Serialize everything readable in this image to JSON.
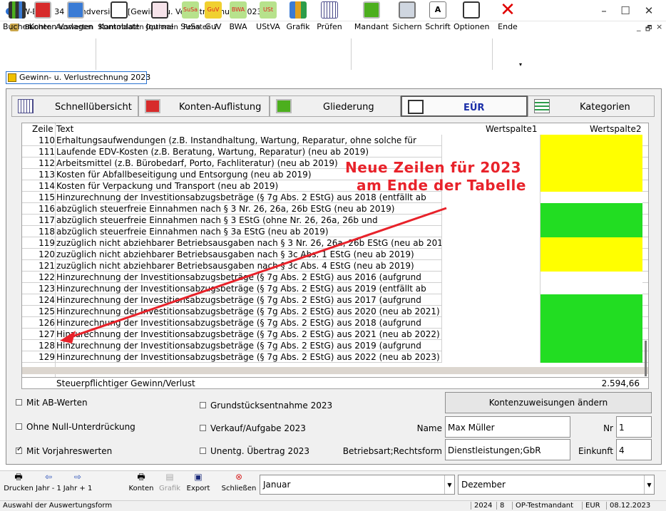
{
  "window": {
    "title": "RW-Buch 34 Grundversion  - [Gewinn- u. Verlustrechnung 2023]",
    "minimize": "–",
    "maximize": "☐",
    "close": "✕"
  },
  "menu": {
    "items": [
      "Buchen",
      "Auswerten",
      "Stammdaten",
      "Optionen",
      "Fenster",
      "?"
    ],
    "mdi_minimize": "_",
    "mdi_restore": "🗗",
    "mdi_close": "×"
  },
  "toolbar": {
    "buttons": [
      {
        "label": "Buchen",
        "icon": "ledger-icon"
      },
      {
        "label": "Konten",
        "icon": "accounts-icon"
      },
      {
        "label": "Vorlagen",
        "icon": "templates-icon"
      },
      {
        "label": "Kontoblatt",
        "icon": "account-sheet-icon"
      },
      {
        "label": "Journal",
        "icon": "journal-icon"
      },
      {
        "label": "SuSa",
        "icon": "susa-icon"
      },
      {
        "label": "GuV",
        "icon": "guv-icon"
      },
      {
        "label": "BWA",
        "icon": "bwa-icon"
      },
      {
        "label": "UStVA",
        "icon": "ustva-icon"
      },
      {
        "label": "Grafik",
        "icon": "chart-icon"
      },
      {
        "label": "Prüfen",
        "icon": "check-icon"
      },
      {
        "label": "Mandant",
        "icon": "client-icon"
      },
      {
        "label": "Sichern",
        "icon": "backup-icon"
      },
      {
        "label": "Schrift",
        "icon": "font-icon"
      },
      {
        "label": "Optionen",
        "icon": "options-icon"
      },
      {
        "label": "Ende",
        "icon": "exit-icon"
      }
    ],
    "icon_texts": {
      "susa": "SuSa",
      "guv": "GuV",
      "bwa": "BWA",
      "ust": "USt"
    },
    "colors": {
      "exit": "#e00000",
      "green": "#4caf1e",
      "red": "#d72b2b"
    }
  },
  "doc_tab": {
    "label": "Gewinn- u. Verlustrechnung 2023"
  },
  "view_tabs": [
    {
      "label": "Schnellübersicht",
      "icon": "calendar-grid-icon",
      "active": false
    },
    {
      "label": "Konten-Auflistung",
      "icon": "box-icon",
      "active": false
    },
    {
      "label": "Gliederung",
      "icon": "box-icon",
      "active": false
    },
    {
      "label": "EÜR",
      "icon": "euer-icon",
      "active": true
    },
    {
      "label": "Kategorien",
      "icon": "categories-icon",
      "active": false
    }
  ],
  "grid": {
    "headers": {
      "zeile": "Zeile",
      "text": "Text",
      "w1": "Wertspalte1",
      "w2": "Wertspalte2"
    },
    "rows": [
      {
        "nr": "110",
        "text": "Erhaltungsaufwendungen (z.B. Instandhaltung, Wartung, Reparatur, ohne solche für",
        "w2": "yellow"
      },
      {
        "nr": "111",
        "text": "Laufende EDV-Kosten (z.B. Beratung, Wartung, Reparatur) (neu ab 2019)",
        "w2": "yellow"
      },
      {
        "nr": "112",
        "text": "Arbeitsmittel (z.B. Bürobedarf, Porto, Fachliteratur) (neu ab 2019)",
        "w2": "yellow"
      },
      {
        "nr": "113",
        "text": "Kosten für Abfallbeseitigung und Entsorgung (neu ab 2019)",
        "w2": "yellow"
      },
      {
        "nr": "114",
        "text": "Kosten für Verpackung und Transport (neu ab 2019)",
        "w2": "yellow"
      },
      {
        "nr": "115",
        "text": "Hinzurechnung der Investitionsabzugsbeträge (§ 7g Abs. 2 EStG) aus 2018 (entfällt ab",
        "w2": "white"
      },
      {
        "nr": "116",
        "text": "abzüglich steuerfreie Einnahmen nach § 3 Nr. 26, 26a, 26b EStG (neu ab 2019)",
        "w2": "green"
      },
      {
        "nr": "117",
        "text": "abzüglich steuerfreie Einnahmen nach § 3 EStG (ohne Nr. 26, 26a, 26b und",
        "w2": "green"
      },
      {
        "nr": "118",
        "text": "abzüglich steuerfreie Einnahmen nach § 3a EStG (neu ab 2019)",
        "w2": "green"
      },
      {
        "nr": "119",
        "text": "zuzüglich nicht abziehbarer Betriebsausgaben nach § 3 Nr. 26, 26a, 26b EStG (neu ab 2019)",
        "w2": "yellow"
      },
      {
        "nr": "120",
        "text": "zuzüglich nicht abziehbarer Betriebsausgaben nach § 3c Abs. 1 EStG (neu ab 2019)",
        "w2": "yellow"
      },
      {
        "nr": "121",
        "text": "zuzüglich nicht abziehbarer Betriebsausgaben nach § 3c Abs. 4 EStG (neu ab 2019)",
        "w2": "yellow"
      },
      {
        "nr": "122",
        "text": "Hinzurechnung der Investitionsabzugsbeträge (§ 7g Abs. 2 EStG) aus 2016 (aufgrund",
        "w2": "white"
      },
      {
        "nr": "123",
        "text": "Hinzurechnung der Investitionsabzugsbeträge (§ 7g Abs. 2 EStG) aus 2019 (entfällt ab",
        "w2": "white"
      },
      {
        "nr": "124",
        "text": "Hinzurechnung der Investitionsabzugsbeträge (§ 7g Abs. 2 EStG) aus 2017 (aufgrund",
        "w2": "green"
      },
      {
        "nr": "125",
        "text": "Hinzurechnung der Investitionsabzugsbeträge (§ 7g Abs. 2 EStG) aus 2020 (neu ab 2021)",
        "w2": "green"
      },
      {
        "nr": "126",
        "text": "Hinzurechnung der Investitionsabzugsbeträge (§ 7g Abs. 2 EStG) aus 2018 (aufgrund",
        "w2": "green"
      },
      {
        "nr": "127",
        "text": "Hinzurechnung der Investitionsabzugsbeträge (§ 7g Abs. 2 EStG) aus 2021 (neu ab 2022)",
        "w2": "green"
      },
      {
        "nr": "128",
        "text": "Hinzurechnung der Investitionsabzugsbeträge (§ 7g Abs. 2 EStG) aus 2019 (aufgrund",
        "w2": "green"
      },
      {
        "nr": "129",
        "text": "Hinzurechnung der Investitionsabzugsbeträge (§ 7g Abs. 2 EStG) aus 2022 (neu ab 2023)",
        "w2": "green"
      }
    ],
    "cell_colors": {
      "yellow": "#ffff00",
      "green": "#22dd22",
      "white": "#ffffff"
    },
    "sum_label": "Steuerpflichtiger Gewinn/Verlust",
    "sum_value": "2.594,66"
  },
  "annotation": {
    "line1": "Neue Zeilen für 2023",
    "line2": "am Ende der Tabelle",
    "color": "#e8222a"
  },
  "options": {
    "mit_ab_werten": {
      "label": "Mit AB-Werten",
      "checked": false
    },
    "ohne_null": {
      "label": "Ohne Null-Unterdrückung",
      "checked": false
    },
    "mit_vorjahr": {
      "label": "Mit Vorjahreswerten",
      "checked": true
    },
    "grundstueck": {
      "label": "Grundstücksentnahme 2023",
      "checked": false
    },
    "verkauf": {
      "label": "Verkauf/Aufgabe 2023",
      "checked": false
    },
    "unentg": {
      "label": "Unentg. Übertrag 2023",
      "checked": false
    }
  },
  "form": {
    "konten_button": "Kontenzuweisungen ändern",
    "name_label": "Name",
    "name_value": "Max Müller",
    "nr_label": "Nr",
    "nr_value": "1",
    "betriebsart_label": "Betriebsart;Rechtsform",
    "betriebsart_value": "Dienstleistungen;GbR",
    "einkunft_label": "Einkunft",
    "einkunft_value": "4"
  },
  "bottombar": {
    "drucken": "Drucken",
    "jahr_minus": "Jahr - 1",
    "jahr_plus": "Jahr + 1",
    "konten": "Konten",
    "grafik": "Grafik",
    "export": "Export",
    "schliessen": "Schließen",
    "from_month": "Januar",
    "to_month": "Dezember"
  },
  "statusbar": {
    "hint": "Auswahl der Auswertungsform",
    "year": "2024",
    "period": "8",
    "client": "OP-Testmandant",
    "currency": "EUR",
    "date": "08.12.2023"
  }
}
